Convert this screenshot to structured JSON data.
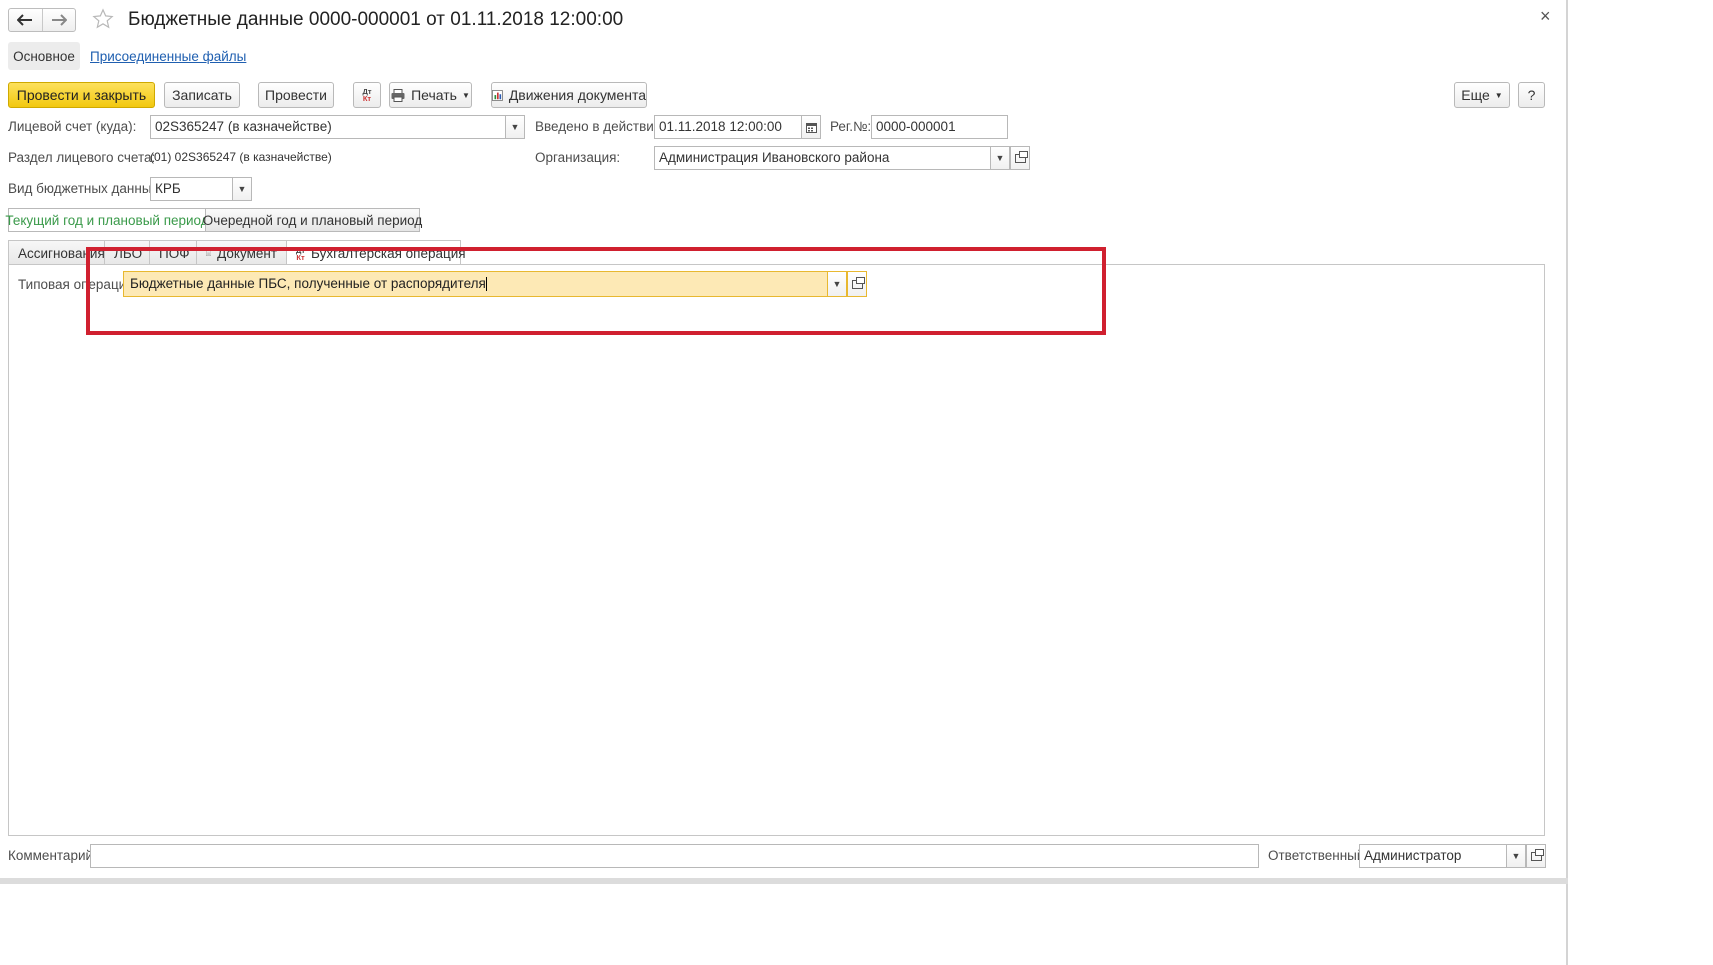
{
  "window": {
    "title": "Бюджетные данные 0000-000001 от 01.11.2018 12:00:00",
    "close": "×"
  },
  "nav": {
    "main": "Основное",
    "attached_files": "Присоединенные файлы"
  },
  "toolbar": {
    "post_close": "Провести и закрыть",
    "save": "Записать",
    "post": "Провести",
    "dt": "Дт",
    "kt": "Кт",
    "print": "Печать",
    "movements": "Движения документа",
    "more": "Еще",
    "help": "?"
  },
  "form": {
    "account_label": "Лицевой счет (куда):",
    "account_value": "02S365247 (в казначействе)",
    "effective_label": "Введено в действие:",
    "effective_value": "01.11.2018 12:00:00",
    "regno_label": "Рег.№:",
    "regno_value": "0000-000001",
    "section_label": "Раздел лицевого счета:",
    "section_value": "(01) 02S365247 (в казначействе)",
    "org_label": "Организация:",
    "org_value": "Администрация Ивановского района",
    "kind_label": "Вид бюджетных данных:",
    "kind_value": "КРБ"
  },
  "periods": {
    "current": "Текущий год и плановый период",
    "next": "Очередной год и плановый период"
  },
  "tabs": [
    "Ассигнования",
    "ЛБО",
    "ПОФ",
    "Документ",
    "Бухгалтерская операция"
  ],
  "operation": {
    "label": "Типовая операция:",
    "value": "Бюджетные данные ПБС, полученные от распорядителя"
  },
  "footer": {
    "comment_label": "Комментарий:",
    "comment_value": "",
    "responsible_label": "Ответственный:",
    "responsible_value": "Администратор"
  },
  "colors": {
    "accent": "#f2c80f",
    "highlight_frame": "#d0202f",
    "active_period": "#3a9a4a",
    "link": "#1f5fb0",
    "focus_field": "#fde9b5"
  }
}
